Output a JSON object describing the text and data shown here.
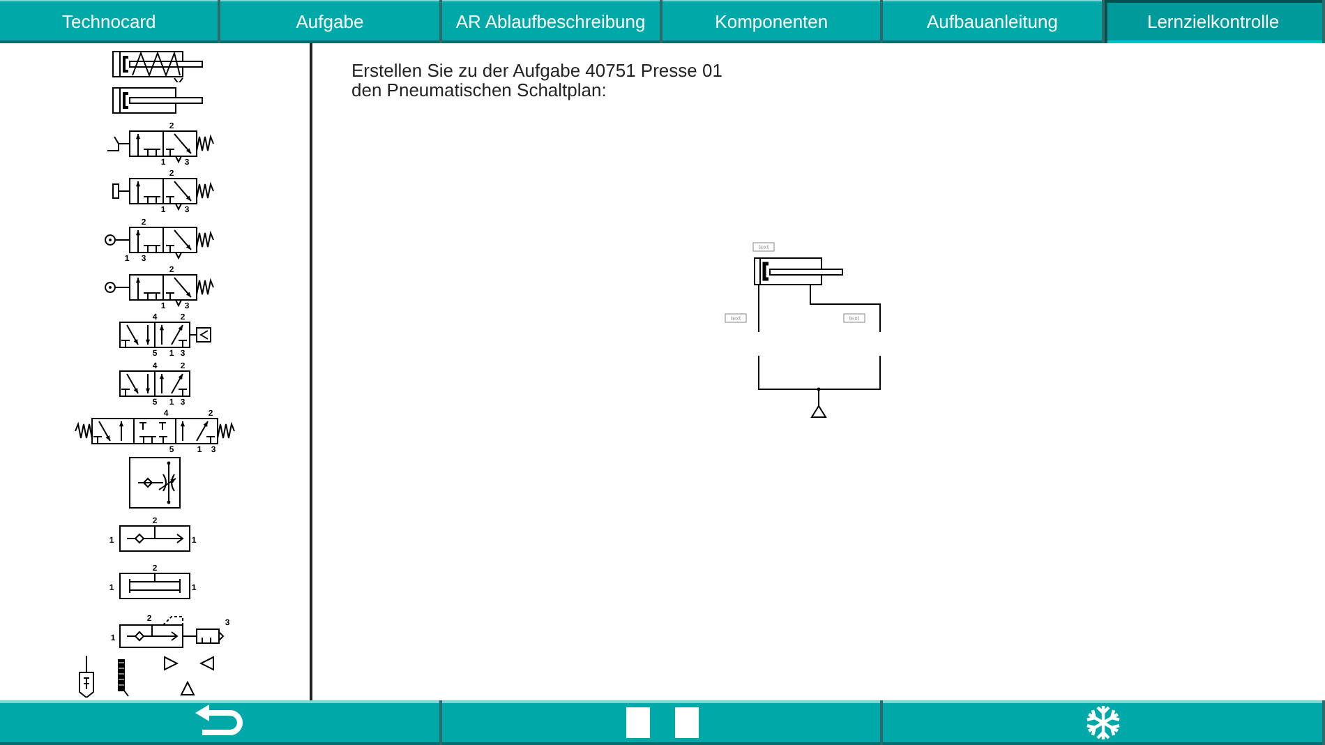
{
  "tabs": [
    {
      "label": "Technocard",
      "selected": false
    },
    {
      "label": "Aufgabe",
      "selected": false
    },
    {
      "label": "AR Ablaufbeschreibung",
      "selected": false
    },
    {
      "label": "Komponenten",
      "selected": false
    },
    {
      "label": "Aufbauanleitung",
      "selected": false
    },
    {
      "label": "Lernzielkontrolle",
      "selected": true
    }
  ],
  "palette": [
    {
      "kind": "cylinder_single"
    },
    {
      "kind": "cylinder_double"
    },
    {
      "kind": "valve32_pedal",
      "ports": [
        "2",
        "1",
        "3"
      ]
    },
    {
      "kind": "valve32_button",
      "ports": [
        "2",
        "1",
        "3"
      ]
    },
    {
      "kind": "valve32_roller_a",
      "ports": [
        "2",
        "1",
        "3"
      ]
    },
    {
      "kind": "valve32_roller",
      "ports": [
        "2",
        "1",
        "3"
      ]
    },
    {
      "kind": "valve52_pilot",
      "ports": [
        "4",
        "2",
        "5",
        "1",
        "3"
      ]
    },
    {
      "kind": "valve52",
      "ports": [
        "4",
        "2",
        "5",
        "1",
        "3"
      ]
    },
    {
      "kind": "valve53",
      "ports": [
        "4",
        "2",
        "5",
        "1",
        "3"
      ]
    },
    {
      "kind": "flow_control"
    },
    {
      "kind": "shuttle",
      "ports": [
        "2",
        "1",
        "1"
      ]
    },
    {
      "kind": "two_pressure",
      "ports": [
        "2",
        "1",
        "1"
      ]
    },
    {
      "kind": "quick_exhaust",
      "ports": [
        "2",
        "1",
        "3"
      ]
    },
    {
      "kind": "misc"
    }
  ],
  "task": {
    "text": "Erstellen Sie zu der Aufgabe 40751 Presse 01\nden Pneumatischen Schaltplan:"
  },
  "diagram": {
    "labels": [
      "text",
      "text",
      "text"
    ]
  },
  "bottom_buttons": [
    {
      "kind": "back"
    },
    {
      "kind": "pause"
    },
    {
      "kind": "freeze"
    }
  ]
}
